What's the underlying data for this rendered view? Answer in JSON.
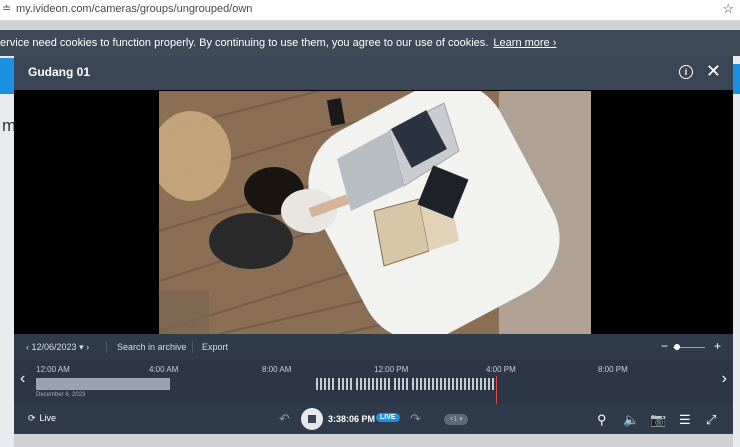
{
  "browser": {
    "url": "my.ivideon.com/cameras/groups/ungrouped/own",
    "left_glyph": "≐",
    "star_icon": "☆"
  },
  "cookie": {
    "text": "ervice need cookies to function properly. By continuing to use them, you agree to our use of cookies.",
    "learn_more": "Learn more ›"
  },
  "background": {
    "left_letter": "m"
  },
  "modal": {
    "title": "Gudang 01",
    "info_icon": "i",
    "close_icon": "✕"
  },
  "toolbar": {
    "date": "12/06/2023",
    "search_archive": "Search in archive",
    "export": "Export",
    "zoom_level": 0.05
  },
  "timeline": {
    "labels": [
      {
        "text": "12:00 AM"
      },
      {
        "text": "4:00 AM"
      },
      {
        "text": "8:00 AM"
      },
      {
        "text": "12:00 PM"
      },
      {
        "text": "4:00 PM"
      },
      {
        "text": "8:00 PM"
      }
    ],
    "date": "December 6, 2023"
  },
  "controls": {
    "live_label": "Live",
    "time": "3:38:06 PM",
    "live_badge": "LIVE",
    "speed": "×1 ▾"
  },
  "colors": {
    "accent": "#1a91e3",
    "modal_bg": "#3a4556",
    "playhead": "#e34b4b"
  }
}
